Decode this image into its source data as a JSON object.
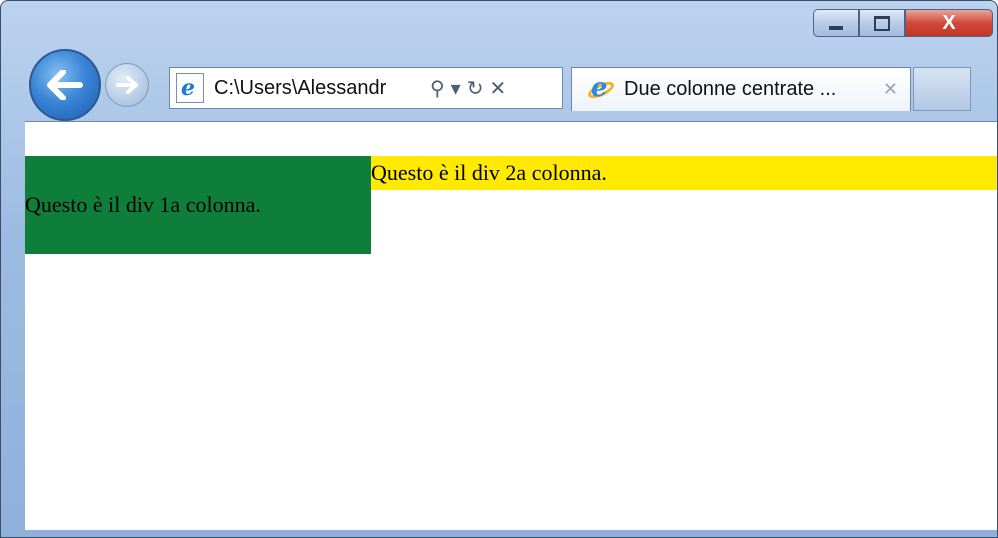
{
  "window": {
    "minimize_glyph": "",
    "maximize_glyph": "",
    "close_glyph": "X"
  },
  "nav": {
    "back_icon": "back-arrow",
    "forward_icon": "forward-arrow"
  },
  "address_bar": {
    "value": "C:\\Users\\Alessandr",
    "search_glyph": "⚲",
    "dropdown_glyph": "▾",
    "refresh_glyph": "↻",
    "stop_glyph": "✕"
  },
  "tab": {
    "title": "Due colonne centrate ...",
    "close_glyph": "✕"
  },
  "page": {
    "col1_text": "Questo è il div 1a colonna.",
    "col2_text": "Questo è il div 2a colonna.",
    "col1_color": "#0f7e3b",
    "col2_color": "#ffea00"
  }
}
